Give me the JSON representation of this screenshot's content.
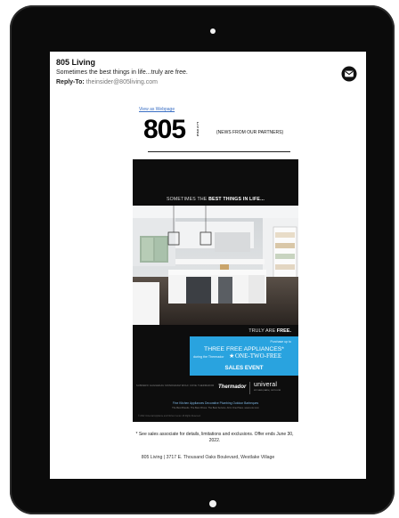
{
  "email": {
    "sender": "805 Living",
    "subject": "Sometimes the best things in life...truly are free.",
    "reply_label": "Reply-To:",
    "reply_address": "theinsider@805living.com",
    "view_link": "View as Webpage",
    "logo_number": "805",
    "logo_word": "LIVING",
    "partners": "{NEWS FROM OUR PARTNERS}",
    "footnote": "* See sales associate for details, limitations and exclusions. Offer ends June 30, 2022.",
    "address": "805 Living | 3717 E. Thousand Oaks Boulevard, Westlake Village"
  },
  "ad": {
    "headline_pre": "SOMETIMES THE ",
    "headline_bold": "BEST THINGS IN LIFE...",
    "truly_pre": "TRULY ARE ",
    "truly_bold": "FREE.",
    "promo_small": "Purchase up to",
    "promo_three": "THREE FREE APPLIANCES*",
    "promo_line2": "during the Thermador",
    "promo_otf": "ONE-TWO-FREE",
    "promo_sales": "SALES EVENT",
    "mini_brands": "SUBZERO   GAGGENAU   MONOGRAM   WOLF   COVE   THERMADOR",
    "thermador": "Thermador",
    "universal": "univeral",
    "universal_sub": "KITCHEN | BATH | OUTDOOR",
    "fine": "Fine Kitchen Appliances   Decorative Plumbing   Outdoor Barbeques",
    "tagline": "The Best Brands. The Best Prices. The Best Service. All in One Place. www.univ.com",
    "legal": "© 2022 Universal Appliance and Kitchen Center. All Rights Reserved."
  },
  "colors": {
    "promo_blue": "#29a3df",
    "link_blue": "#3a6fc4",
    "device_black": "#0b0b0b"
  },
  "icons": {
    "mail": "envelope-circle-icon"
  }
}
